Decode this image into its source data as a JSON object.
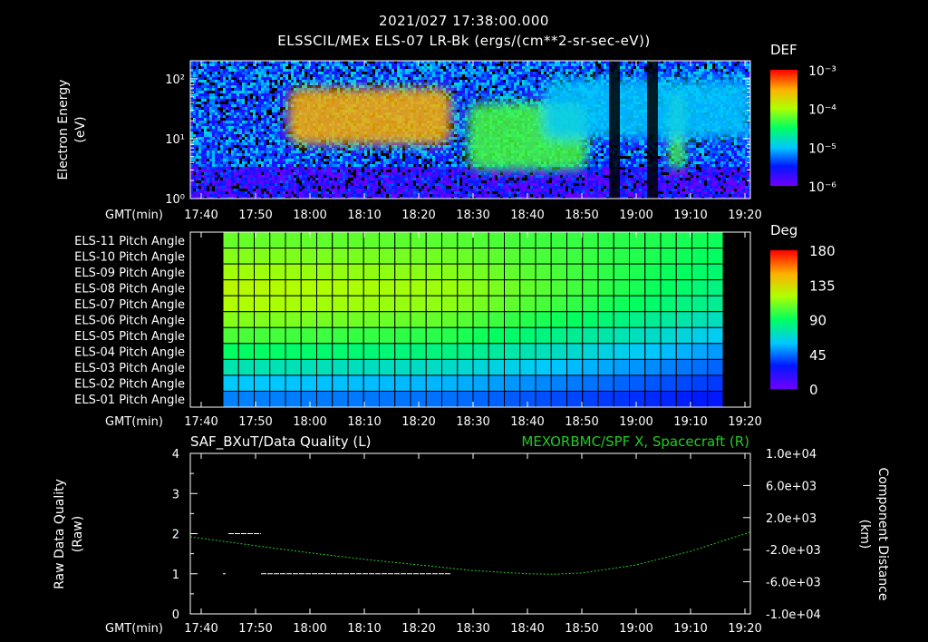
{
  "header": {
    "timestamp": "2021/027 17:38:00.000",
    "instrument": "ELSSCIL/MEx ELS-07 LR-Bk  (ergs/(cm**2-sr-sec-eV))"
  },
  "colors": {
    "background": "#000000",
    "axis": "#ffffff",
    "right_series": "#22cc22"
  },
  "time_axis": {
    "label": "GMT(min)",
    "ticks": [
      "17:40",
      "17:50",
      "18:00",
      "18:10",
      "18:20",
      "18:30",
      "18:40",
      "18:50",
      "19:00",
      "19:10",
      "19:20"
    ]
  },
  "chart_data": [
    {
      "type": "heatmap",
      "name": "energy-spectrogram",
      "ylabel": "Electron Energy",
      "yunit": "(eV)",
      "y_scale": "log",
      "ylim": [
        1,
        200
      ],
      "y_ticks": [
        "10²",
        "10¹",
        "10⁰"
      ],
      "y_tick_values": [
        100,
        10,
        1
      ],
      "xlim": [
        "17:38",
        "19:21"
      ],
      "colorbar": {
        "title": "DEF",
        "ticks": [
          "10⁻³",
          "10⁻⁴",
          "10⁻⁵",
          "10⁻⁶"
        ],
        "tick_values": [
          0.001,
          0.0001,
          1e-05,
          1e-06
        ]
      },
      "enhanced_regions": [
        {
          "start": "17:56",
          "end": "18:26",
          "e_min": 8,
          "e_max": 70,
          "peak_def": 0.0003
        },
        {
          "start": "18:29",
          "end": "18:51",
          "e_min": 3,
          "e_max": 40,
          "peak_def": 5e-05
        },
        {
          "start": "19:06",
          "end": "19:09",
          "e_min": 3,
          "e_max": 60,
          "peak_def": 5e-05
        },
        {
          "start": "18:43",
          "end": "19:21",
          "e_min": 10,
          "e_max": 100,
          "peak_def": 1e-05
        }
      ],
      "data_gaps": [
        {
          "start": "18:55",
          "end": "18:57"
        },
        {
          "start": "19:02",
          "end": "19:04"
        }
      ]
    },
    {
      "type": "heatmap",
      "name": "pitch-angle",
      "rows": [
        "ELS-11 Pitch Angle",
        "ELS-10 Pitch Angle",
        "ELS-09 Pitch Angle",
        "ELS-08 Pitch Angle",
        "ELS-07 Pitch Angle",
        "ELS-06 Pitch Angle",
        "ELS-05 Pitch Angle",
        "ELS-04 Pitch Angle",
        "ELS-03 Pitch Angle",
        "ELS-02 Pitch Angle",
        "ELS-01 Pitch Angle"
      ],
      "data_start": "17:44",
      "data_end": "19:16",
      "num_columns": 32,
      "colorbar": {
        "title": "Deg",
        "ticks": [
          "180",
          "135",
          "90",
          "45",
          "0"
        ],
        "tick_values": [
          180,
          135,
          90,
          45,
          0
        ]
      },
      "values_start": [
        108,
        113,
        118,
        123,
        121,
        113,
        103,
        90,
        75,
        60,
        48
      ],
      "values_end": [
        92,
        90,
        87,
        84,
        80,
        72,
        62,
        52,
        43,
        36,
        30
      ]
    },
    {
      "type": "line",
      "name": "data-quality-and-distance",
      "left_title": "SAF_BXuT/Data Quality (L)",
      "right_title": "MEXORBMC/SPF X, Spacecraft (R)",
      "ylabel_left": "Raw Data Quality",
      "yunit_left": "(Raw)",
      "ylim_left": [
        0,
        4
      ],
      "yticks_left": [
        "4",
        "3",
        "2",
        "1",
        "0"
      ],
      "ylabel_right": "Component Distance",
      "yunit_right": "(km)",
      "ylim_right": [
        -10000,
        10000
      ],
      "yticks_right": [
        "1.0e+04",
        "6.0e+03",
        "2.0e+03",
        "-2.0e+03",
        "-6.0e+03",
        "-1.0e+04"
      ],
      "series": [
        {
          "name": "SAF_BXuT/Data Quality",
          "axis": "left",
          "segments": [
            {
              "start": "17:44",
              "end": "17:44.5",
              "value": 1
            },
            {
              "start": "17:45",
              "end": "17:51",
              "value": 2
            },
            {
              "start": "17:51",
              "end": "18:26",
              "value": 1
            },
            {
              "start": "18:26",
              "end": "19:16",
              "value": 0
            }
          ]
        },
        {
          "name": "MEXORBMC/SPF X, Spacecraft",
          "axis": "right",
          "x": [
            "17:38",
            "17:50",
            "18:00",
            "18:10",
            "18:20",
            "18:30",
            "18:40",
            "18:45",
            "18:50",
            "19:00",
            "19:10",
            "19:21"
          ],
          "values": [
            -400,
            -1500,
            -2400,
            -3200,
            -3900,
            -4600,
            -5000,
            -5050,
            -4900,
            -3900,
            -2200,
            200
          ]
        }
      ]
    }
  ]
}
